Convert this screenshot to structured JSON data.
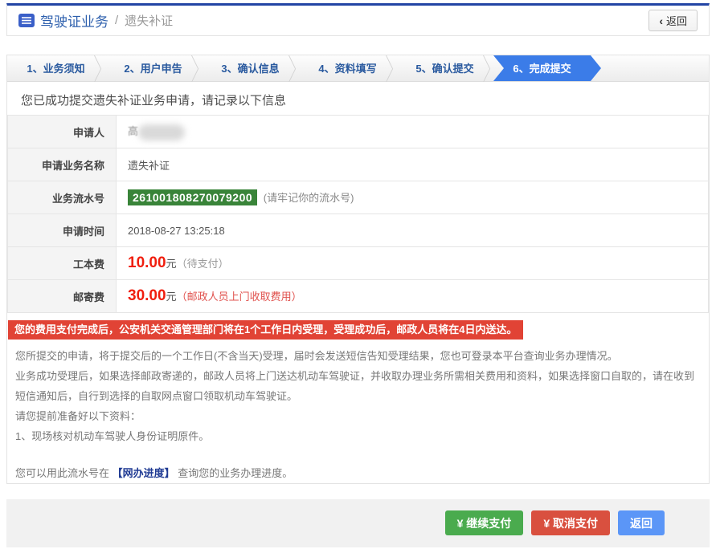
{
  "header": {
    "title": "驾驶证业务",
    "separator": "/",
    "subtitle": "遗失补证",
    "back_icon": "‹",
    "back_label": "返回"
  },
  "steps": [
    {
      "label": "1、业务须知",
      "active": false
    },
    {
      "label": "2、用户申告",
      "active": false
    },
    {
      "label": "3、确认信息",
      "active": false
    },
    {
      "label": "4、资料填写",
      "active": false
    },
    {
      "label": "5、确认提交",
      "active": false
    },
    {
      "label": "6、完成提交",
      "active": true
    }
  ],
  "main": {
    "success_message": "您已成功提交遗失补证业务申请，请记录以下信息",
    "info_table": {
      "rows": [
        {
          "label": "申请人",
          "value": "高"
        },
        {
          "label": "申请业务名称",
          "value": "遗失补证"
        },
        {
          "label": "业务流水号",
          "serial": "261001808270079200",
          "note": "(请牢记你的流水号)"
        },
        {
          "label": "申请时间",
          "value": "2018-08-27 13:25:18"
        },
        {
          "label": "工本费",
          "amount": "10.00",
          "unit": "元",
          "note": "（待支付）"
        },
        {
          "label": "邮寄费",
          "amount": "30.00",
          "unit": "元",
          "note": "（邮政人员上门收取费用）"
        }
      ]
    },
    "alert": "您的费用支付完成后，公安机关交通管理部门将在1个工作日内受理，受理成功后，邮政人员将在4日内送达。",
    "paragraphs": [
      "您所提交的申请，将于提交后的一个工作日(不含当天)受理，届时会发送短信告知受理结果，您也可登录本平台查询业务办理情况。",
      "业务成功受理后，如果选择邮政寄递的，邮政人员将上门送达机动车驾驶证，并收取办理业务所需相关费用和资料，如果选择窗口自取的，请在收到短信通知后，自行到选择的自取网点窗口领取机动车驾驶证。",
      "请您提前准备好以下资料：",
      "1、现场核对机动车驾驶人身份证明原件。"
    ],
    "progress_note": {
      "prefix": "您可以用此流水号在 ",
      "link": "【网办进度】",
      "suffix": " 查询您的业务办理进度。"
    }
  },
  "footer": {
    "continue_pay_label": "¥ 继续支付",
    "cancel_pay_label": "¥ 取消支付",
    "return_label": "返回"
  },
  "colors": {
    "top_bar": "#2244a4",
    "title_blue": "#2d5fad",
    "active_step": "#3b7ce8",
    "serial_badge_green": "#398439",
    "alert_red": "#e14335",
    "fee_red": "#f01e0e",
    "button_green": "#4aab4e",
    "button_red": "#d9503f",
    "button_blue": "#5b96f7"
  }
}
